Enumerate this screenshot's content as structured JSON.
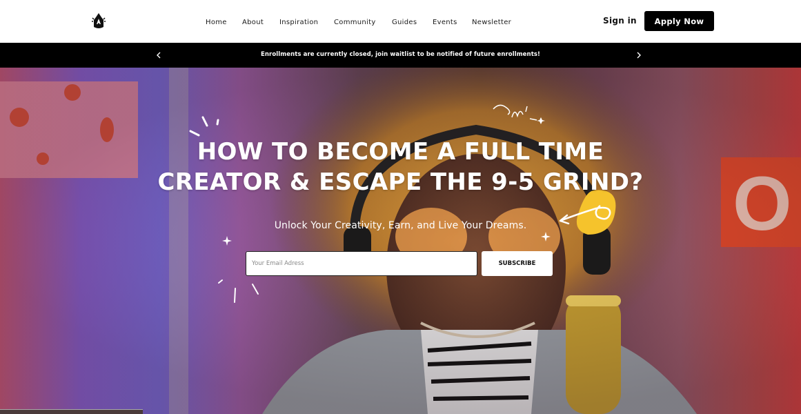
{
  "header": {
    "nav": [
      "Home",
      "About",
      "Inspiration",
      "Community",
      "Guides",
      "Events",
      "Newsletter"
    ],
    "sign_in": "Sign in",
    "apply": "Apply Now"
  },
  "announcement": {
    "text": "Enrollments are currently closed, join waitlist to be notified of future enrollments!"
  },
  "hero": {
    "title_line1": "HOW TO BECOME A FULL TIME",
    "title_line2": "CREATOR & ESCAPE THE 9-5 GRIND?",
    "subtitle": "Unlock Your Creativity, Earn, and Live Your Dreams.",
    "email_placeholder": "Your Email Adress",
    "subscribe": "SUBSCRIBE"
  },
  "colors": {
    "header_bg": "#ffffff",
    "announce_bg": "#000000",
    "button_bg": "#000000",
    "accent_yellow": "#f5c32c"
  },
  "icons": [
    "logo-icon",
    "chevron-left-icon",
    "chevron-right-icon",
    "sparkle-icon",
    "scribble-icon",
    "arrow-doodle-icon"
  ]
}
